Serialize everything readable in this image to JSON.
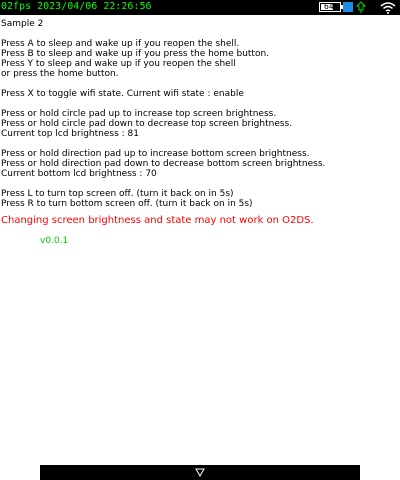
{
  "status_bar": {
    "text": "02fps 2023/04/06 22:26:56",
    "battery_level": "64",
    "battery_fill": 0.64,
    "colors": {
      "status_text": "#00ff00",
      "battery_accent": "#1e8ce6"
    },
    "icons": [
      "battery-icon",
      "plug-icon",
      "wifi-icon"
    ]
  },
  "main": {
    "title": "Sample 2",
    "lines": [
      "Press A to sleep and wake up if you reopen the shell.",
      "Press B to sleep and wake up if you press the home button.",
      "Press Y to sleep and wake up if you reopen the shell",
      "or press the home button.",
      "",
      "Press X to toggle wifi state. Current wifi state : enable",
      "",
      "Press or hold circle pad up to increase top screen brightness.",
      "Press or hold circle pad down to decrease top screen brightness.",
      "Current top lcd brightness : 81",
      "",
      "Press or hold direction pad up to increase bottom screen brightness.",
      "Press or hold direction pad down to decrease bottom screen brightness.",
      "Current bottom lcd brightness : 70",
      "",
      "Press L to turn top screen off. (turn it back on in 5s)",
      "Press R to turn bottom screen off. (turn it back on in 5s)"
    ],
    "warning": "Changing screen brightness and state may not work on O2DS.",
    "version": "v0.0.1",
    "colors": {
      "text": "#000000",
      "warning": "#ff0000",
      "version": "#00cc00"
    }
  },
  "bottom_bar": {
    "icon": "down-arrow-icon"
  }
}
